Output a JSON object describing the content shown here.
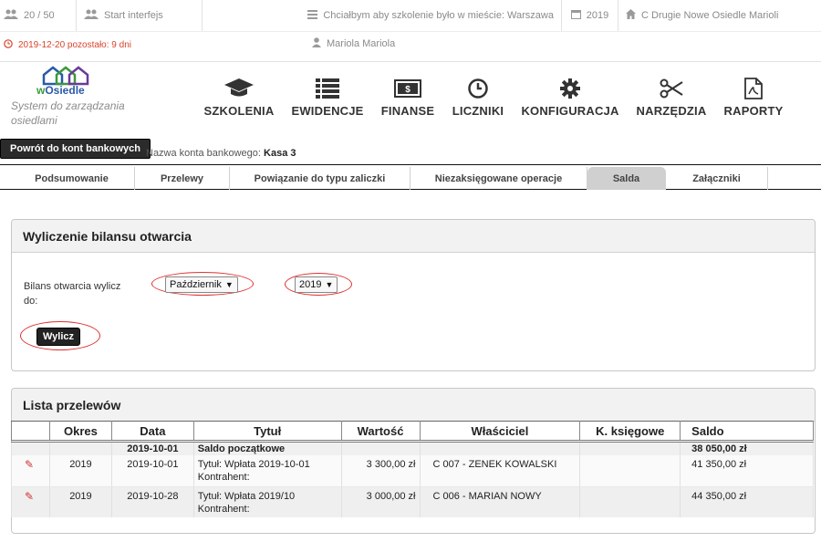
{
  "topbar": {
    "users_count": "20 / 50",
    "start_label": "Start interfejs",
    "training_wish": "Chciałbym aby szkolenie było w mieście: Warszawa",
    "year": "2019",
    "community": "C Drugie Nowe Osiedle Marioli",
    "deadline": "2019-12-20 pozostało: 9 dni",
    "user": "Mariola Mariola"
  },
  "brand": {
    "logo_w": "w",
    "logo_name": "Osiedle",
    "slogan": "System do zarządzania osiedlami"
  },
  "nav": [
    {
      "label": "SZKOLENIA",
      "icon": "graduation-cap-icon"
    },
    {
      "label": "EWIDENCJE",
      "icon": "list-icon"
    },
    {
      "label": "FINANSE",
      "icon": "money-icon"
    },
    {
      "label": "LICZNIKI",
      "icon": "clock-icon"
    },
    {
      "label": "KONFIGURACJA",
      "icon": "gear-icon"
    },
    {
      "label": "NARZĘDZIA",
      "icon": "scissors-icon"
    },
    {
      "label": "RAPORTY",
      "icon": "pdf-file-icon"
    }
  ],
  "back_button": "Powrót do kont bankowych",
  "account": {
    "label": "Nazwa konta bankowego:",
    "value": "Kasa 3"
  },
  "tabs": [
    "Podsumowanie",
    "Przelewy",
    "Powiązanie do typu zaliczki",
    "Niezaksięgowane operacje",
    "Salda",
    "Załączniki"
  ],
  "active_tab": "Salda",
  "opening": {
    "title": "Wyliczenie bilansu otwarcia",
    "label": "Bilans otwarcia wylicz do:",
    "month": "Październik",
    "year": "2019",
    "button": "Wylicz"
  },
  "transfers": {
    "title": "Lista przelewów",
    "columns": [
      "",
      "Okres",
      "Data",
      "Tytuł",
      "Wartość",
      "Właściciel",
      "K. księgowe",
      "Saldo"
    ],
    "opening_row": {
      "date": "2019-10-01",
      "title": "Saldo początkowe",
      "saldo": "38 050,00 zł"
    },
    "rows": [
      {
        "period": "2019",
        "date": "2019-10-01",
        "title": "Tytuł: Wpłata 2019-10-01",
        "contractor": "Kontrahent:",
        "value": "3 300,00 zł",
        "owner": "C 007 - ZENEK KOWALSKI",
        "accounting": "",
        "saldo": "41 350,00 zł"
      },
      {
        "period": "2019",
        "date": "2019-10-28",
        "title": "Tytuł: Wpłata 2019/10",
        "contractor": "Kontrahent:",
        "value": "3 000,00 zł",
        "owner": "C 006 - MARIAN NOWY",
        "accounting": "",
        "saldo": "44 350,00 zł"
      }
    ]
  },
  "colors": {
    "accent_red": "#e03030",
    "deadline": "#d9432b",
    "dark_button": "#222222"
  }
}
